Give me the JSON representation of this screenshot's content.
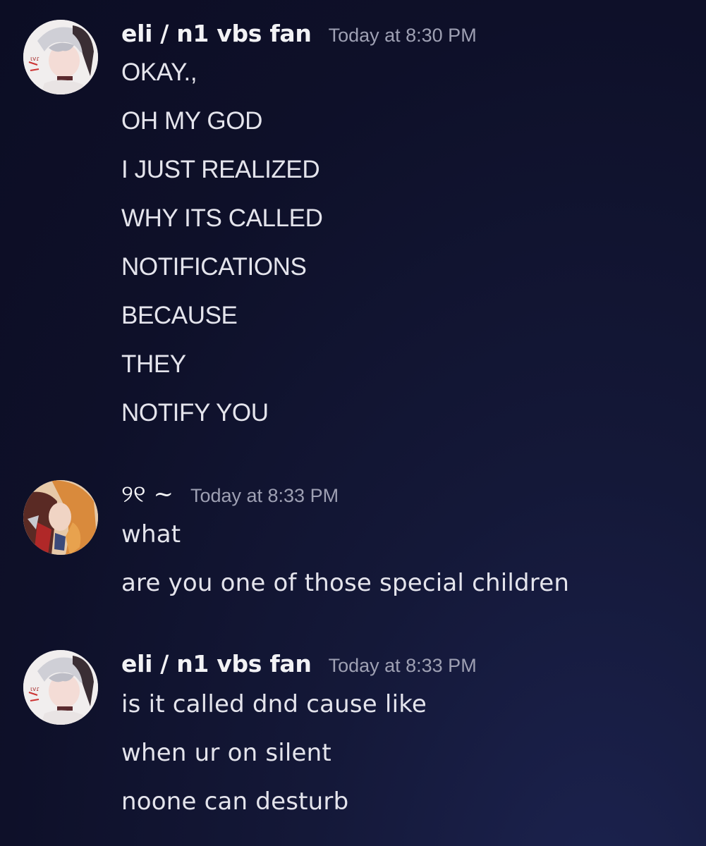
{
  "messages": [
    {
      "author": "eli / n1 vbs fan",
      "timestamp": "Today at 8:30 PM",
      "avatar_icon": "user-avatar-anime",
      "lines": [
        "OKAY.,",
        "OH MY GOD",
        "I JUST REALIZED",
        "WHY ITS CALLED",
        "NOTIFICATIONS",
        "BECAUSE",
        "THEY",
        "NOTIFY YOU"
      ]
    },
    {
      "author": "୨୧ ~",
      "timestamp": "Today at 8:33 PM",
      "avatar_icon": "user-avatar-anime-orange",
      "lines": [
        "what",
        "are you one of those special children"
      ]
    },
    {
      "author": "eli / n1 vbs fan",
      "timestamp": "Today at 8:33 PM",
      "avatar_icon": "user-avatar-anime",
      "lines": [
        "is it called dnd cause like",
        "when ur on silent",
        "noone can desturb"
      ]
    }
  ],
  "colors": {
    "background": "#0e1029",
    "username": "#f2f2f5",
    "timestamp": "#9ea0b3",
    "message_text": "#e4e4ec"
  }
}
